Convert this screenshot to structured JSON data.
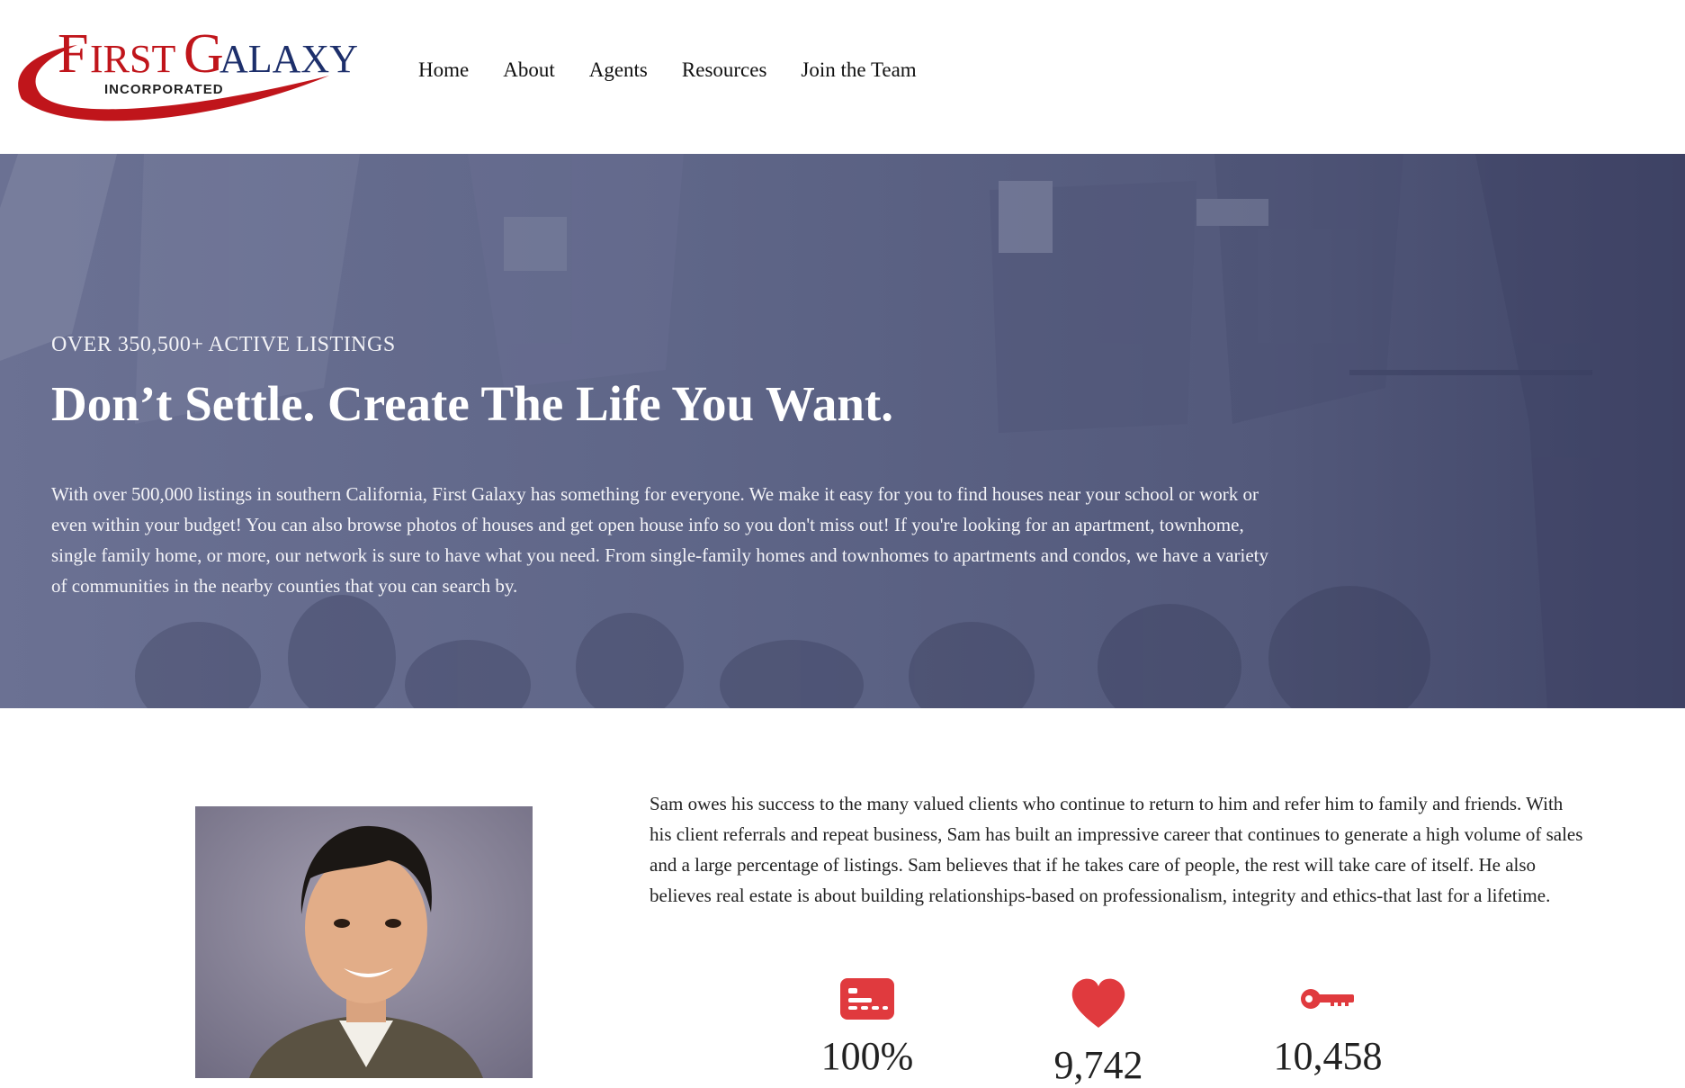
{
  "brand": {
    "name_first": "FIRST",
    "name_second": "GALAXY",
    "tagline": "INCORPORATED",
    "color_red": "#c0151b",
    "color_blue": "#1d2f6b"
  },
  "nav": {
    "items": [
      {
        "label": "Home"
      },
      {
        "label": "About"
      },
      {
        "label": "Agents"
      },
      {
        "label": "Resources"
      },
      {
        "label": "Join the Team"
      }
    ]
  },
  "hero": {
    "overline": "OVER 350,500+ ACTIVE LISTINGS",
    "title": "Don’t Settle. Create The Life You Want.",
    "body": "With over 500,000 listings in southern California, First Galaxy has something for everyone. We make it easy for you to find houses near your school or work or even within your budget! You can also browse photos of houses and get open house info so you don't miss out! If you're looking for an apartment, townhome, single family home, or more, our network is sure to have what you need. From single-family homes and townhomes to apartments and condos, we have a variety of communities in the nearby counties that you can search by."
  },
  "about": {
    "bio": "Sam owes his success to the many valued clients who continue to return to him and refer him to family and friends. With his client referrals and repeat business, Sam has built an impressive career that continues to generate a high volume of sales and a large percentage of listings. Sam believes that if he takes care of people, the rest will take care of itself. He also believes real estate is about building relationships-based on professionalism, integrity and ethics-that last for a lifetime.",
    "stats": [
      {
        "icon": "id-card-icon",
        "value": "100%"
      },
      {
        "icon": "heart-icon",
        "value": "9,742"
      },
      {
        "icon": "key-icon",
        "value": "10,458"
      }
    ],
    "accent_color": "#e03a3e"
  }
}
